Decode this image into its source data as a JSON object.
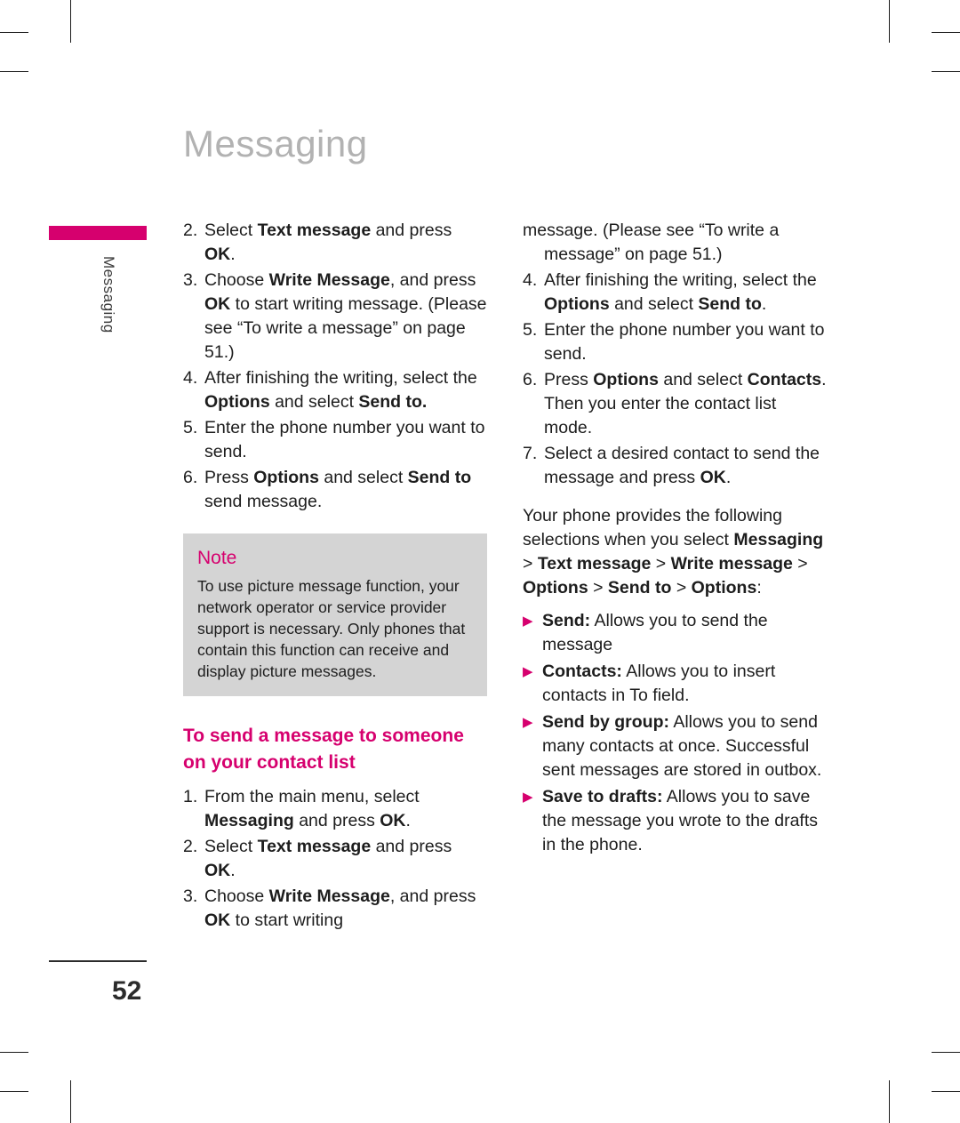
{
  "page": {
    "title": "Messaging",
    "side_tab_label": "Messaging",
    "number": "52"
  },
  "left_column": {
    "steps": [
      {
        "num": "2.",
        "parts": [
          {
            "t": "Select ",
            "b": false
          },
          {
            "t": "Text message",
            "b": true
          },
          {
            "t": " and press ",
            "b": false
          },
          {
            "t": "OK",
            "b": true
          },
          {
            "t": ".",
            "b": false
          }
        ]
      },
      {
        "num": "3.",
        "parts": [
          {
            "t": "Choose ",
            "b": false
          },
          {
            "t": "Write Message",
            "b": true
          },
          {
            "t": ", and press ",
            "b": false
          },
          {
            "t": "OK",
            "b": true
          },
          {
            "t": " to start writing message. (Please see “To write a message” on page 51.)",
            "b": false
          }
        ]
      },
      {
        "num": "4.",
        "parts": [
          {
            "t": "After finishing the writing, select the ",
            "b": false
          },
          {
            "t": "Options",
            "b": true
          },
          {
            "t": " and select ",
            "b": false
          },
          {
            "t": "Send to.",
            "b": true
          }
        ]
      },
      {
        "num": "5.",
        "parts": [
          {
            "t": "Enter the phone number you want to send.",
            "b": false
          }
        ]
      },
      {
        "num": "6.",
        "parts": [
          {
            "t": "Press ",
            "b": false
          },
          {
            "t": "Options",
            "b": true
          },
          {
            "t": " and select ",
            "b": false
          },
          {
            "t": "Send to",
            "b": true
          },
          {
            "t": " send message.",
            "b": false
          }
        ]
      }
    ],
    "note": {
      "title": "Note",
      "text": "To use picture message function, your network operator or service provider support is necessary. Only phones that contain this function can receive and display picture messages."
    },
    "subheading": "To send a message to someone on your contact list",
    "steps2": [
      {
        "num": "1.",
        "parts": [
          {
            "t": "From the main menu, select ",
            "b": false
          },
          {
            "t": "Messaging",
            "b": true
          },
          {
            "t": " and press ",
            "b": false
          },
          {
            "t": "OK",
            "b": true
          },
          {
            "t": ".",
            "b": false
          }
        ]
      },
      {
        "num": "2.",
        "parts": [
          {
            "t": "Select ",
            "b": false
          },
          {
            "t": "Text message",
            "b": true
          },
          {
            "t": " and press ",
            "b": false
          },
          {
            "t": "OK",
            "b": true
          },
          {
            "t": ".",
            "b": false
          }
        ]
      },
      {
        "num": "3.",
        "parts": [
          {
            "t": "Choose ",
            "b": false
          },
          {
            "t": "Write Message",
            "b": true
          },
          {
            "t": ", and press ",
            "b": false
          },
          {
            "t": "OK",
            "b": true
          },
          {
            "t": " to start writing",
            "b": false
          }
        ]
      }
    ]
  },
  "right_column": {
    "continuation": "message. (Please see “To write a message” on page 51.)",
    "steps": [
      {
        "num": "4.",
        "parts": [
          {
            "t": "After finishing the writing, select the ",
            "b": false
          },
          {
            "t": "Options",
            "b": true
          },
          {
            "t": " and select ",
            "b": false
          },
          {
            "t": "Send to",
            "b": true
          },
          {
            "t": ".",
            "b": false
          }
        ]
      },
      {
        "num": "5.",
        "parts": [
          {
            "t": "Enter the phone number you want to send.",
            "b": false
          }
        ]
      },
      {
        "num": "6.",
        "parts": [
          {
            "t": "Press ",
            "b": false
          },
          {
            "t": "Options",
            "b": true
          },
          {
            "t": " and select ",
            "b": false
          },
          {
            "t": "Contacts",
            "b": true
          },
          {
            "t": ". Then you enter the contact list mode.",
            "b": false
          }
        ]
      },
      {
        "num": "7.",
        "parts": [
          {
            "t": "Select a desired contact to send the message and press ",
            "b": false
          },
          {
            "t": "OK",
            "b": true
          },
          {
            "t": ".",
            "b": false
          }
        ]
      }
    ],
    "intro": [
      {
        "t": "Your phone provides the following selections when you select ",
        "b": false
      },
      {
        "t": "Messaging",
        "b": true
      },
      {
        "t": " > ",
        "b": false
      },
      {
        "t": "Text message",
        "b": true
      },
      {
        "t": " > ",
        "b": false
      },
      {
        "t": "Write message",
        "b": true
      },
      {
        "t": " > ",
        "b": false
      },
      {
        "t": "Options",
        "b": true
      },
      {
        "t": " > ",
        "b": false
      },
      {
        "t": "Send to",
        "b": true
      },
      {
        "t": " > ",
        "b": false
      },
      {
        "t": "Options",
        "b": true
      },
      {
        "t": ":",
        "b": false
      }
    ],
    "bullet_marker": "▶",
    "bullets": [
      {
        "parts": [
          {
            "t": "Send:",
            "b": true
          },
          {
            "t": " Allows you to send the message",
            "b": false
          }
        ]
      },
      {
        "parts": [
          {
            "t": "Contacts:",
            "b": true
          },
          {
            "t": " Allows you to insert contacts in To field.",
            "b": false
          }
        ]
      },
      {
        "parts": [
          {
            "t": "Send by group:",
            "b": true
          },
          {
            "t": " Allows you to send many contacts at once. Successful sent messages are stored in outbox.",
            "b": false
          }
        ]
      },
      {
        "parts": [
          {
            "t": "Save to drafts:",
            "b": true
          },
          {
            "t": " Allows you to save the message you wrote to the drafts in the phone.",
            "b": false
          }
        ]
      }
    ]
  },
  "colors": {
    "accent": "#d6006e",
    "title_gray": "#b2b2b2",
    "note_bg": "#d4d4d4",
    "text": "#1d1d1d"
  }
}
